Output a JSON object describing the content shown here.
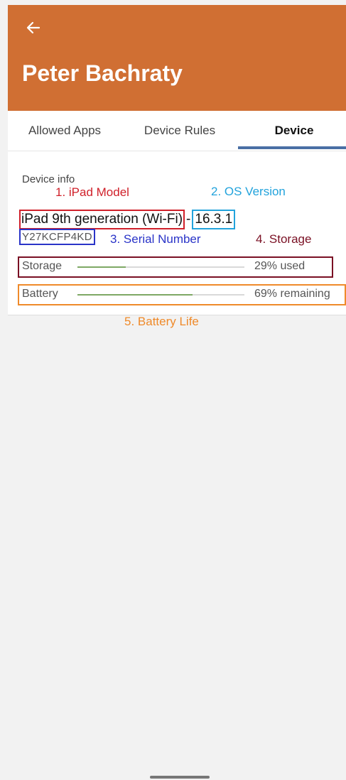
{
  "header": {
    "back_icon": "arrow-left-icon",
    "title": "Peter Bachraty"
  },
  "tabs": [
    {
      "label": "Allowed Apps",
      "active": false
    },
    {
      "label": "Device Rules",
      "active": false
    },
    {
      "label": "Device",
      "active": true
    }
  ],
  "device_info": {
    "section_label": "Device info",
    "model": "iPad 9th generation (Wi-Fi)",
    "separator": "-",
    "os_version": "16.3.1",
    "serial": "Y27KCFP4KD",
    "storage": {
      "label": "Storage",
      "value_text": "29% used",
      "fraction": 0.29
    },
    "battery": {
      "label": "Battery",
      "value_text": "69% remaining",
      "fraction": 0.69
    }
  },
  "annotations": {
    "model": "1. iPad Model",
    "os_version": "2. OS Version",
    "serial": "3. Serial Number",
    "storage": "4. Storage",
    "battery": "5. Battery Life"
  },
  "colors": {
    "appbar": "#d06f33",
    "tab_indicator": "#4a6fa5",
    "meter_fill": "#7ea864",
    "annot_model": "#d0202a",
    "annot_os": "#22a3dc",
    "annot_serial": "#2a34c8",
    "annot_storage": "#7a1024",
    "annot_battery": "#ef8a2a"
  }
}
